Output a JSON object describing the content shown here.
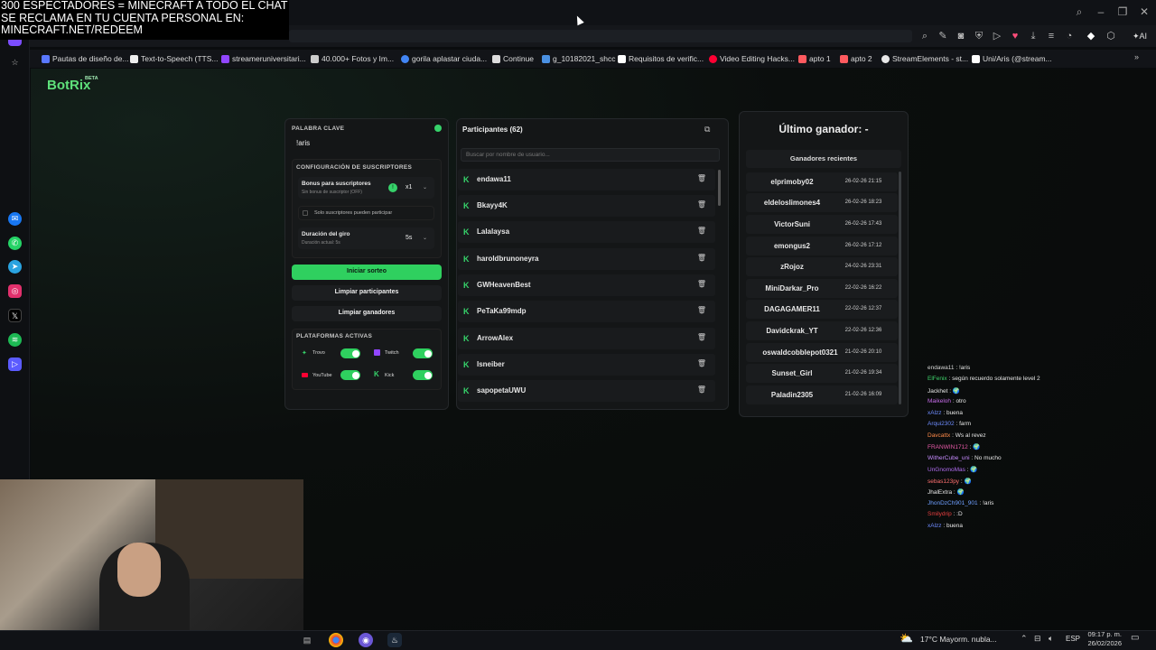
{
  "stream_overlay": {
    "line1": "300 ESPECTADORES = MINECRAFT A TODO EL CHAT",
    "line2": "SE RECLAMA EN TU CUENTA PERSONAL EN:",
    "line3": "MINECRAFT.NET/REDEEM"
  },
  "browser": {
    "ai_label": "AI",
    "bookmarks": [
      {
        "label": "Pautas de diseño de...",
        "color": "#5a78ff"
      },
      {
        "label": "Text-to-Speech (TTS...",
        "color": "#eeeeee"
      },
      {
        "label": "streameruniversitari...",
        "color": "#9146ff"
      },
      {
        "label": "40.000+ Fotos y Im...",
        "color": "#cccccc"
      },
      {
        "label": "gorila aplastar ciuda...",
        "color": "#4285f4"
      },
      {
        "label": "Continue",
        "color": "#dddddd"
      },
      {
        "label": "g_10182021_shcc",
        "color": "#4a90e2"
      },
      {
        "label": "Requisitos de verific...",
        "color": "#ffffff"
      },
      {
        "label": "Video Editing Hacks...",
        "color": "#ff0033"
      },
      {
        "label": "apto 1",
        "color": "#ff5a5f"
      },
      {
        "label": "apto 2",
        "color": "#ff5a5f"
      },
      {
        "label": "StreamElements - st...",
        "color": "#e8e8e8"
      },
      {
        "label": "Uni/Aris (@stream...",
        "color": "#ffffff"
      }
    ]
  },
  "app": {
    "logo": "BotRix",
    "beta": "BETA",
    "keyword": {
      "label": "PALABRA CLAVE",
      "value": "!aris"
    },
    "subs_config": {
      "title": "CONFIGURACIÓN DE SUSCRIPTORES",
      "bonus_label": "Bonus para suscriptores",
      "bonus_sub": "Sin bonus de suscriptor (OFF)",
      "bonus_value": "x1",
      "only_subs": "Solo suscriptores pueden participar",
      "spin_label": "Duración del giro",
      "spin_sub": "Duración actual: 5s",
      "spin_value": "5s"
    },
    "buttons": {
      "start": "Iniciar sorteo",
      "clear_participants": "Limpiar participantes",
      "clear_winners": "Limpiar ganadores"
    },
    "platforms": {
      "title": "PLATAFORMAS ACTIVAS",
      "items": [
        {
          "name": "Trovo",
          "enabled": true
        },
        {
          "name": "Twitch",
          "enabled": true
        },
        {
          "name": "YouTube",
          "enabled": true
        },
        {
          "name": "Kick",
          "enabled": true
        }
      ]
    },
    "participants": {
      "title": "Participantes (62)",
      "search_placeholder": "Buscar por nombre de usuario...",
      "items": [
        "endawa11",
        "Bkayy4K",
        "Lalalaysa",
        "haroldbrunoneyra",
        "GWHeavenBest",
        "PeTaKa99mdp",
        "ArrowAlex",
        "Isneiber",
        "sapopetaUWU"
      ]
    },
    "winners": {
      "last_winner": "Último ganador: -",
      "recent_title": "Ganadores recientes",
      "items": [
        {
          "name": "elprimoby02",
          "date": "26-02-26 21:15"
        },
        {
          "name": "eldeloslimones4",
          "date": "26-02-26 18:23"
        },
        {
          "name": "VictorSuni",
          "date": "26-02-26 17:43"
        },
        {
          "name": "emongus2",
          "date": "26-02-26 17:12"
        },
        {
          "name": "zRojoz",
          "date": "24-02-26 23:31"
        },
        {
          "name": "MiniDarkar_Pro",
          "date": "22-02-26 16:22"
        },
        {
          "name": "DAGAGAMER11",
          "date": "22-02-26 12:37"
        },
        {
          "name": "Davidckrak_YT",
          "date": "22-02-26 12:36"
        },
        {
          "name": "oswaldcobblepot0321",
          "date": "21-02-26 20:10"
        },
        {
          "name": "Sunset_Girl",
          "date": "21-02-26 19:34"
        },
        {
          "name": "Paladin2305",
          "date": "21-02-26 16:09"
        }
      ]
    }
  },
  "chat": [
    {
      "user": "endawa11",
      "color": "#d6d6d6",
      "msg": "!aris"
    },
    {
      "user": "ElFenix",
      "color": "#3fd06a",
      "msg": "según recuerdo solamente level 2"
    },
    {
      "user": "Jackhet",
      "color": "#e8e8e8",
      "msg": "🌍"
    },
    {
      "user": "Maikeloh",
      "color": "#c56be8",
      "msg": "otro"
    },
    {
      "user": "xAlzz",
      "color": "#6f8cff",
      "msg": "buena"
    },
    {
      "user": "Arqui2302",
      "color": "#6f8cff",
      "msg": "farm"
    },
    {
      "user": "Davcattx",
      "color": "#ff8a4a",
      "msg": "Ws al revez"
    },
    {
      "user": "FRANWIN1712",
      "color": "#e85aa8",
      "msg": "🌍"
    },
    {
      "user": "WitherCube_uni",
      "color": "#c78cff",
      "msg": "No mucho"
    },
    {
      "user": "UnGnomoMas",
      "color": "#b06cf0",
      "msg": "🌍"
    },
    {
      "user": "sebas123py",
      "color": "#ff7070",
      "msg": "🌍"
    },
    {
      "user": "JhalExtra",
      "color": "#e8e8e8",
      "msg": "🌍"
    },
    {
      "user": "JhonDzCh901_901",
      "color": "#6fa0ff",
      "msg": "!aris"
    },
    {
      "user": "Smilydrip",
      "color": "#e84040",
      "msg": ":D"
    },
    {
      "user": "xAlzz",
      "color": "#6f8cff",
      "msg": "buena"
    }
  ],
  "taskbar": {
    "weather": "17°C  Mayorm. nubla...",
    "lang": "ESP",
    "time": "09:17 p. m.",
    "date": "26/02/2026"
  }
}
